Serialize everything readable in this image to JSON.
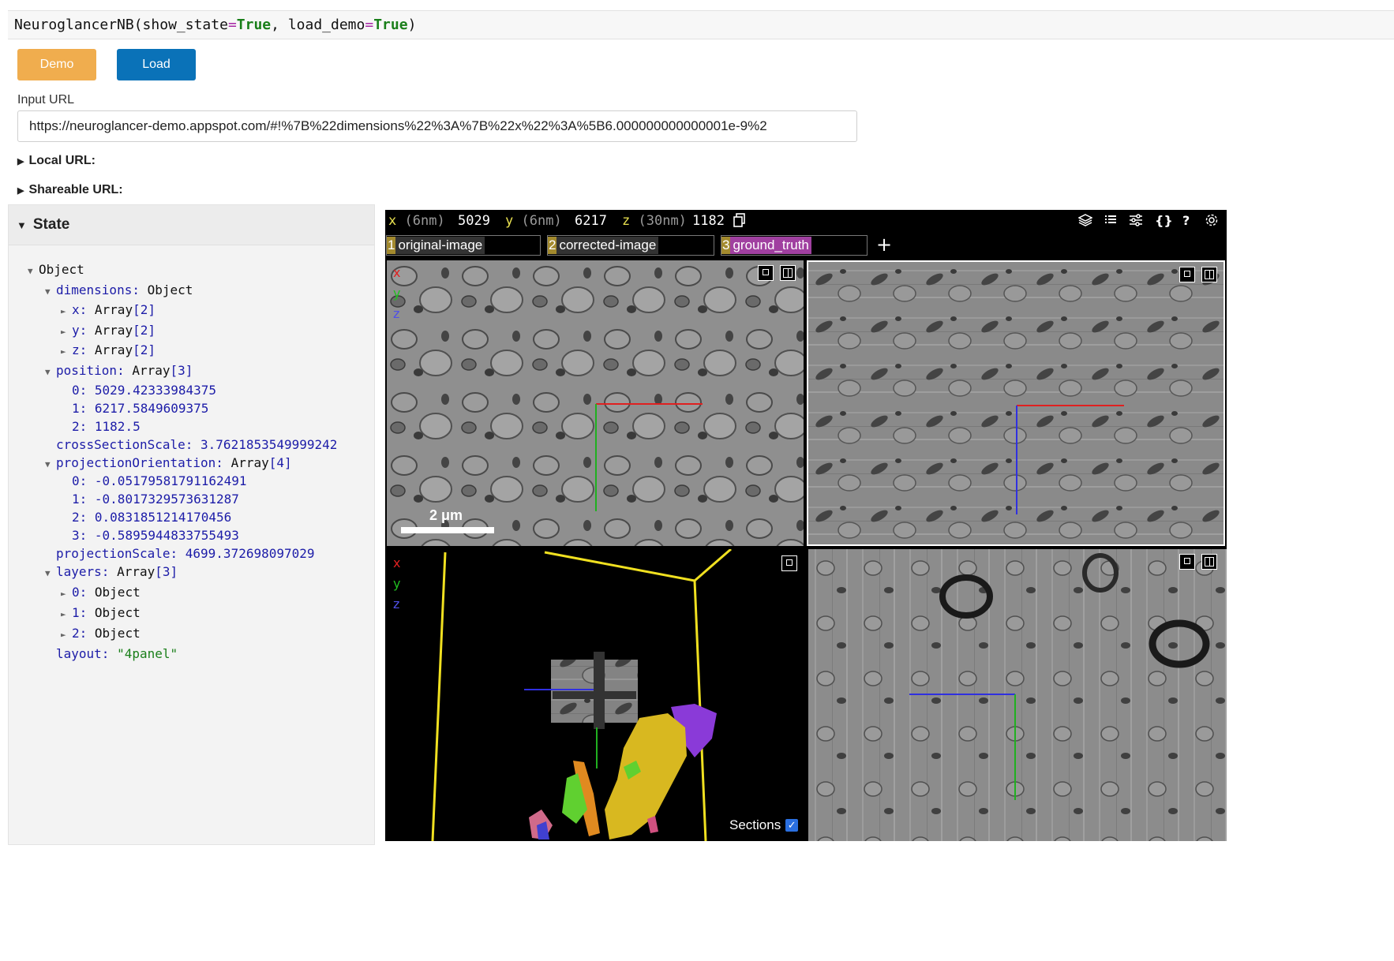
{
  "code_cell": {
    "prefix": "NeuroglancerNB(show_state",
    "eq1": "=",
    "true1": "True",
    "mid": ", load_demo",
    "eq2": "=",
    "true2": "True",
    "suffix": ")"
  },
  "buttons": {
    "demo": "Demo",
    "load": "Load"
  },
  "input": {
    "label": "Input URL",
    "value": "https://neuroglancer-demo.appspot.com/#!%7B%22dimensions%22%3A%7B%22x%22%3A%5B6.000000000000001e-9%2"
  },
  "details": {
    "local_url": "Local URL:",
    "shareable_url": "Shareable URL:"
  },
  "state": {
    "title": "State",
    "tree": [
      {
        "indent": 0,
        "toggle": "▼",
        "key": "",
        "value": "Object",
        "len": "",
        "kind": "obj"
      },
      {
        "indent": 1,
        "toggle": "▼",
        "key": "dimensions:",
        "value": "Object",
        "len": "",
        "kind": "obj"
      },
      {
        "indent": 2,
        "toggle": "►",
        "key": "x:",
        "value": "Array",
        "len": "[2]",
        "kind": "arr"
      },
      {
        "indent": 2,
        "toggle": "►",
        "key": "y:",
        "value": "Array",
        "len": "[2]",
        "kind": "arr"
      },
      {
        "indent": 2,
        "toggle": "►",
        "key": "z:",
        "value": "Array",
        "len": "[2]",
        "kind": "arr"
      },
      {
        "indent": 1,
        "toggle": "▼",
        "key": "position:",
        "value": "Array",
        "len": "[3]",
        "kind": "arr"
      },
      {
        "indent": 2,
        "toggle": "",
        "key": "0:",
        "value": "5029.42333984375",
        "len": "",
        "kind": "num"
      },
      {
        "indent": 2,
        "toggle": "",
        "key": "1:",
        "value": "6217.5849609375",
        "len": "",
        "kind": "num"
      },
      {
        "indent": 2,
        "toggle": "",
        "key": "2:",
        "value": "1182.5",
        "len": "",
        "kind": "num"
      },
      {
        "indent": 1,
        "toggle": "",
        "key": "crossSectionScale:",
        "value": "3.7621853549999242",
        "len": "",
        "kind": "num"
      },
      {
        "indent": 1,
        "toggle": "▼",
        "key": "projectionOrientation:",
        "value": "Array",
        "len": "[4]",
        "kind": "arr"
      },
      {
        "indent": 2,
        "toggle": "",
        "key": "0:",
        "value": "-0.05179581791162491",
        "len": "",
        "kind": "num"
      },
      {
        "indent": 2,
        "toggle": "",
        "key": "1:",
        "value": "-0.8017329573631287",
        "len": "",
        "kind": "num"
      },
      {
        "indent": 2,
        "toggle": "",
        "key": "2:",
        "value": "0.0831851214170456",
        "len": "",
        "kind": "num"
      },
      {
        "indent": 2,
        "toggle": "",
        "key": "3:",
        "value": "-0.5895944833755493",
        "len": "",
        "kind": "num"
      },
      {
        "indent": 1,
        "toggle": "",
        "key": "projectionScale:",
        "value": "4699.372698097029",
        "len": "",
        "kind": "num"
      },
      {
        "indent": 1,
        "toggle": "▼",
        "key": "layers:",
        "value": "Array",
        "len": "[3]",
        "kind": "arr"
      },
      {
        "indent": 2,
        "toggle": "►",
        "key": "0:",
        "value": "Object",
        "len": "",
        "kind": "obj"
      },
      {
        "indent": 2,
        "toggle": "►",
        "key": "1:",
        "value": "Object",
        "len": "",
        "kind": "obj"
      },
      {
        "indent": 2,
        "toggle": "►",
        "key": "2:",
        "value": "Object",
        "len": "",
        "kind": "obj"
      },
      {
        "indent": 1,
        "toggle": "",
        "key": "layout:",
        "value": "\"4panel\"",
        "len": "",
        "kind": "str"
      }
    ]
  },
  "viewer": {
    "coords": {
      "x_label": "x",
      "x_unit": "(6nm)",
      "x_value": "5029",
      "y_label": "y",
      "y_unit": "(6nm)",
      "y_value": "6217",
      "z_label": "z",
      "z_unit": "(30nm)",
      "z_value": "1182"
    },
    "layers": [
      {
        "num": "1",
        "name": "original-image"
      },
      {
        "num": "2",
        "name": "corrected-image"
      },
      {
        "num": "3",
        "name": "ground_truth"
      }
    ],
    "add_layer": "+",
    "help_icon": "?",
    "json_icon": "{}",
    "axis_labels": {
      "x": "x",
      "y": "y",
      "z": "z"
    },
    "scale_bar_label": "2 μm",
    "sections_label": "Sections",
    "sections_checked": true
  },
  "colors": {
    "demo_button": "#f0ad4e",
    "load_button": "#0a72b8",
    "axis_x": "#e02020",
    "axis_y": "#20c020",
    "axis_z": "#5050e8",
    "bounding_box": "#f0e020",
    "layer3_tab": "#a040a0"
  }
}
